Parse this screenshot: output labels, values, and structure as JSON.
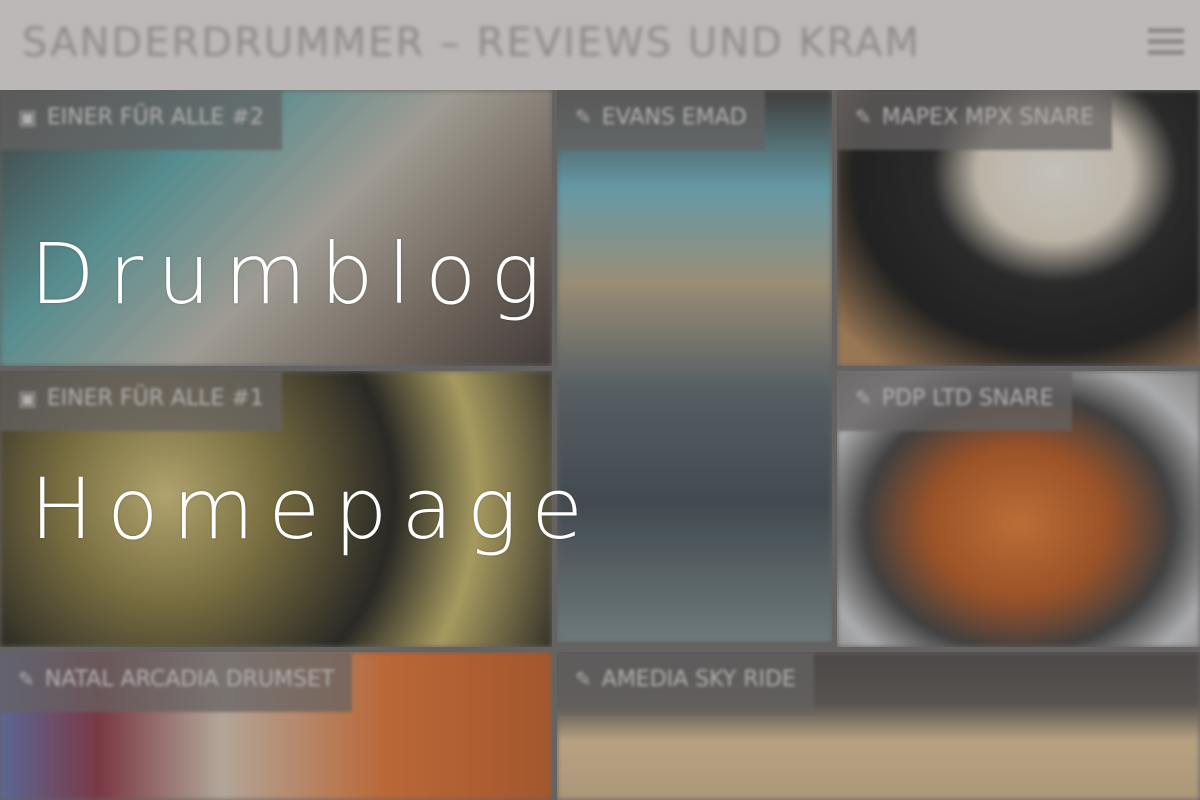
{
  "header": {
    "site_title": "Sanderdrummer – Reviews und Kram",
    "menu_icon": "hamburger-menu-icon"
  },
  "tiles": [
    {
      "label": "Einer für alle #2",
      "icon": "video-camera-icon",
      "accent": "#5aa5a8"
    },
    {
      "label": "Evans EMAD",
      "icon": "pencil-icon",
      "accent": "#6fb7c7"
    },
    {
      "label": "Mapex MPX Snare",
      "icon": "pencil-icon",
      "accent": "#111111"
    },
    {
      "label": "Einer für alle #1",
      "icon": "video-camera-icon",
      "accent": "#d6c47a"
    },
    {
      "label": "PDP LTD Snare",
      "icon": "pencil-icon",
      "accent": "#e57a2c"
    },
    {
      "label": "Natal Arcadia Drumset",
      "icon": "pencil-icon",
      "accent": "#8b3040"
    },
    {
      "label": "Amedia Sky Ride",
      "icon": "pencil-icon",
      "accent": "#e0c296"
    }
  ],
  "hero": {
    "line1": "Drumblog",
    "line2": "Homepage"
  }
}
